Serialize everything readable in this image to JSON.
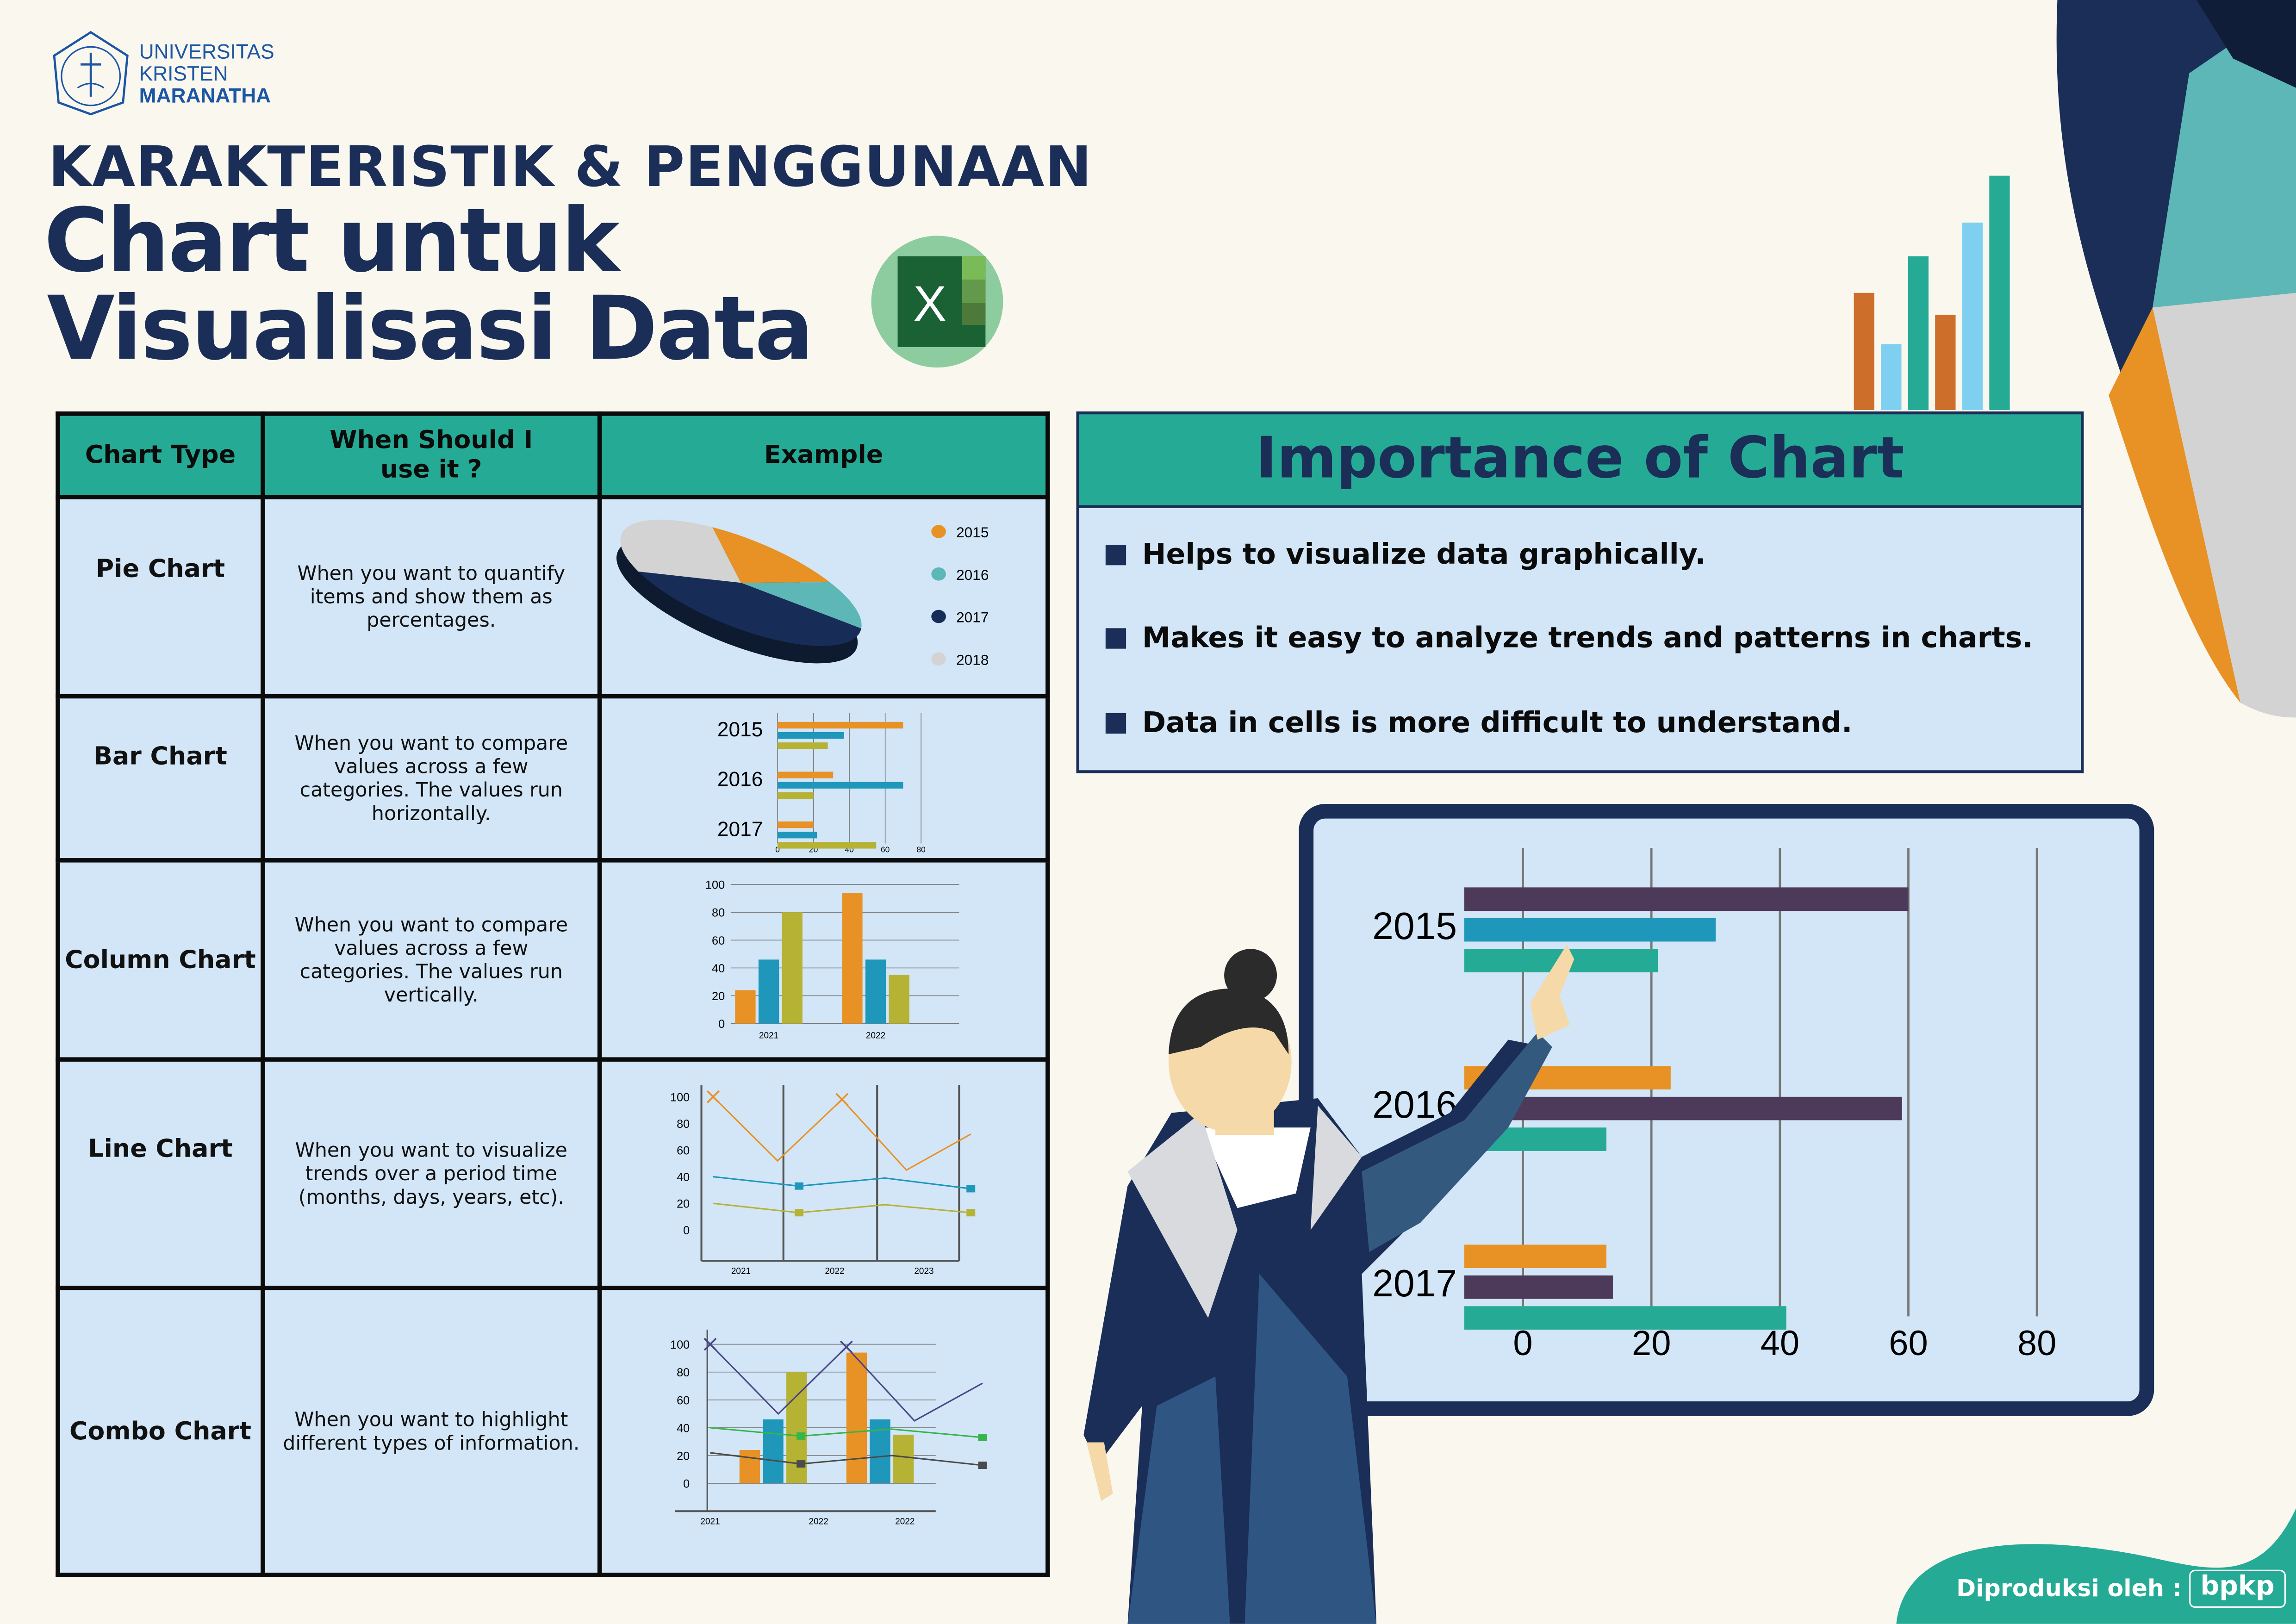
{
  "logo": {
    "line1": "UNIVERSITAS",
    "line2": "KRISTEN",
    "line3": "MARANATHA",
    "seal_text": "UNIVERSITAS KRISTEN MARANATHA BANDUNG MCMLXV"
  },
  "title": {
    "line1": "KARAKTERISTIK & PENGGUNAAN",
    "line2": "Chart untuk",
    "line3": "Visualisasi Data"
  },
  "excel_icon": {
    "letter": "X",
    "color": "#1d6b37",
    "circle": "#8dcc9e"
  },
  "colors": {
    "navy": "#1a2e57",
    "teal": "#25ab95",
    "cell": "#d2e6f7",
    "orange": "#e89225",
    "blue": "#1e97bb",
    "olive": "#b6b234",
    "purple": "#4d3a5a",
    "gray": "#d3d3d3",
    "pie_teal": "#5db7b6"
  },
  "table": {
    "headers": [
      "Chart Type",
      "When Should I use it ?",
      "Example"
    ],
    "rows": [
      {
        "type": "Pie Chart",
        "use": "When you want to quantify items and show them as percentages."
      },
      {
        "type": "Bar Chart",
        "use": "When you want to compare values across a few categories. The values run horizontally."
      },
      {
        "type": "Column Chart",
        "use": "When you want to compare values across a few categories. The values run vertically."
      },
      {
        "type": "Line Chart",
        "use": "When you want to visualize trends over a period time (months, days, years, etc)."
      },
      {
        "type": "Combo Chart",
        "use": "When you want to highlight different types of information."
      }
    ]
  },
  "importance": {
    "title": "Importance of Chart",
    "items": [
      "Helps to visualize data graphically.",
      "Makes it easy to analyze trends and patterns in charts.",
      "Data in cells is more difficult to understand."
    ]
  },
  "footer": {
    "label": "Diproduksi oleh :",
    "logo_text": "bpkp"
  },
  "chart_data": [
    {
      "type": "pie",
      "legend": [
        "2015",
        "2016",
        "2017",
        "2018"
      ],
      "values": [
        17,
        13,
        40,
        30
      ],
      "colors": [
        "#e89225",
        "#5db7b6",
        "#172d58",
        "#d3d3d3"
      ],
      "legend_position": "right"
    },
    {
      "type": "bar",
      "orientation": "horizontal",
      "categories": [
        "2015",
        "2016",
        "2017"
      ],
      "series": [
        {
          "values": [
            70,
            37,
            28
          ]
        },
        {
          "values": [
            31,
            70,
            20
          ]
        },
        {
          "values": [
            20,
            22,
            55
          ]
        }
      ],
      "series_by": "category",
      "colors": [
        "#e89225",
        "#1e97bb",
        "#b6b234"
      ],
      "xlim": [
        0,
        80
      ],
      "xticks": [
        "0",
        "20",
        "40",
        "60",
        "80"
      ],
      "grid": true
    },
    {
      "type": "bar",
      "orientation": "vertical",
      "categories": [
        "2021",
        "2022"
      ],
      "series": [
        {
          "values": [
            24,
            94
          ]
        },
        {
          "values": [
            46,
            46
          ]
        },
        {
          "values": [
            80,
            35
          ]
        }
      ],
      "colors": [
        "#e89225",
        "#1e97bb",
        "#b6b234"
      ],
      "ylim": [
        0,
        100
      ],
      "yticks": [
        "0",
        "20",
        "40",
        "60",
        "80",
        "100"
      ],
      "grid": true
    },
    {
      "type": "line",
      "xticks": [
        "2021",
        "2022",
        "2023"
      ],
      "series": [
        {
          "values": [
            100,
            52,
            98,
            45,
            72
          ],
          "color": "#e89225",
          "marker": "x"
        },
        {
          "values": [
            40,
            33,
            39,
            31
          ],
          "color": "#1e97bb",
          "marker": "square"
        },
        {
          "values": [
            20,
            13,
            19,
            13
          ],
          "color": "#b6b234",
          "marker": "square"
        }
      ],
      "ylim": [
        0,
        100
      ],
      "yticks": [
        "0",
        "20",
        "40",
        "60",
        "80",
        "100"
      ]
    },
    {
      "type": "combo",
      "xticks": [
        "2021",
        "2022",
        "2022"
      ],
      "bars": [
        {
          "values": [
            24,
            94
          ]
        },
        {
          "values": [
            46,
            46
          ]
        },
        {
          "values": [
            80,
            35
          ]
        }
      ],
      "bar_colors": [
        "#e89225",
        "#1e97bb",
        "#b6b234"
      ],
      "lines": [
        {
          "values": [
            100,
            50,
            98,
            45,
            72
          ],
          "color": "#4a4587",
          "marker": "x"
        },
        {
          "values": [
            40,
            34,
            39,
            33
          ],
          "color": "#35b54a",
          "marker": "square"
        },
        {
          "values": [
            22,
            14,
            20,
            13
          ],
          "color": "#4b4b4b",
          "marker": "square"
        }
      ],
      "ylim": [
        0,
        100
      ],
      "yticks": [
        "0",
        "20",
        "40",
        "60",
        "80",
        "100"
      ],
      "grid": true
    },
    {
      "type": "bar",
      "orientation": "horizontal",
      "categories": [
        "2015",
        "2016",
        "2017"
      ],
      "groups": [
        [
          {
            "v": 60,
            "c": "#4d3a5a"
          },
          {
            "v": 30,
            "c": "#1e97bb"
          },
          {
            "v": 21,
            "c": "#25ab95"
          }
        ],
        [
          {
            "v": 23,
            "c": "#e89225"
          },
          {
            "v": 59,
            "c": "#4d3a5a"
          },
          {
            "v": 13,
            "c": "#25ab95"
          }
        ],
        [
          {
            "v": 13,
            "c": "#e89225"
          },
          {
            "v": 14,
            "c": "#4d3a5a"
          },
          {
            "v": 41,
            "c": "#25ab95"
          }
        ]
      ],
      "xlim": [
        0,
        80
      ],
      "xticks": [
        "0",
        "20",
        "40",
        "60",
        "80"
      ],
      "grid": true
    },
    {
      "type": "bar",
      "orientation": "vertical",
      "decorative": true,
      "values": [
        80,
        45,
        105,
        65,
        128,
        160
      ],
      "colors": [
        "#cd6f2b",
        "#7fd0f0",
        "#25ab95",
        "#cd6f2b",
        "#7fd0f0",
        "#25ab95"
      ]
    }
  ]
}
